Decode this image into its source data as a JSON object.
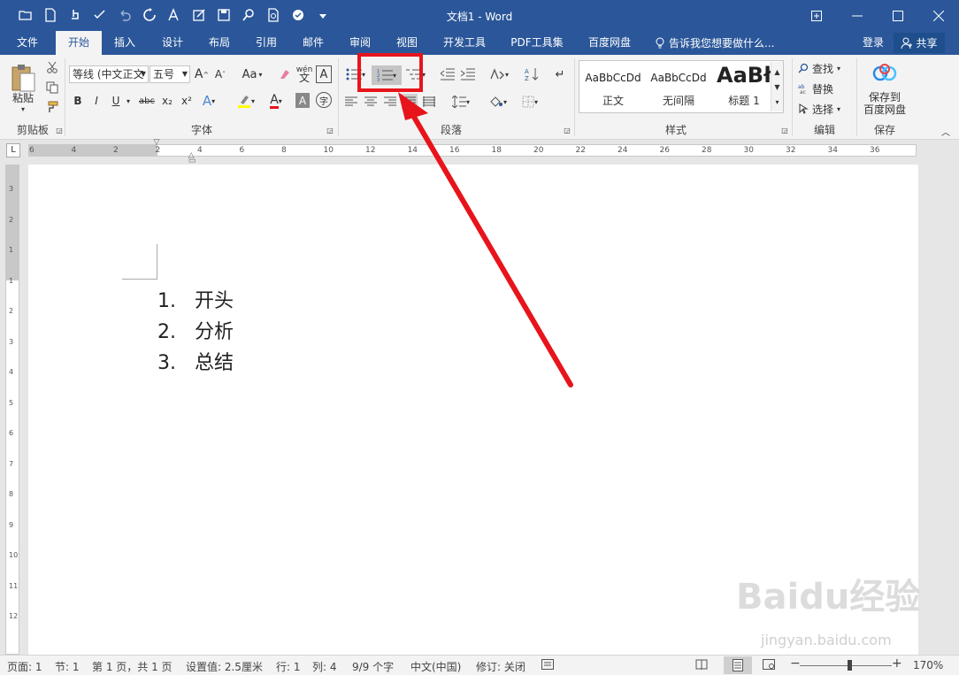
{
  "window": {
    "title": "文档1 - Word"
  },
  "tabs": [
    "文件",
    "开始",
    "插入",
    "设计",
    "布局",
    "引用",
    "邮件",
    "审阅",
    "视图",
    "开发工具",
    "PDF工具集",
    "百度网盘"
  ],
  "tell_me": "告诉我您想要做什么...",
  "login": "登录",
  "share": "共享",
  "clipboard": {
    "paste": "粘贴",
    "label": "剪贴板"
  },
  "font": {
    "name": "等线 (中文正文",
    "size": "五号",
    "label": "字体",
    "aa": "Aa",
    "bold": "B",
    "italic": "I",
    "underline": "U",
    "strike": "abc",
    "sub": "x₂",
    "sup": "x²",
    "wen": "wén",
    "wen_char": "文",
    "a_char": "A",
    "frame_char": "字"
  },
  "paragraph": {
    "label": "段落"
  },
  "styles": {
    "label": "样式",
    "items": [
      {
        "sample": "AaBbCcDd",
        "name": "正文"
      },
      {
        "sample": "AaBbCcDd",
        "name": "无间隔"
      },
      {
        "sample": "AaBł",
        "name": "标题 1"
      }
    ]
  },
  "editing": {
    "label": "编辑",
    "find": "查找",
    "replace": "替换",
    "select": "选择"
  },
  "save": {
    "label": "保存",
    "line1": "保存到",
    "line2": "百度网盘"
  },
  "ruler": {
    "corner": "L",
    "h_ticks": [
      "6",
      "4",
      "2",
      "2",
      "4",
      "6",
      "8",
      "10",
      "12",
      "14",
      "16",
      "18",
      "20",
      "22",
      "24",
      "26",
      "28",
      "30",
      "32",
      "34",
      "36"
    ],
    "v_ticks": [
      "3",
      "2",
      "1",
      "1",
      "2",
      "3",
      "4",
      "5",
      "6",
      "7",
      "8",
      "9",
      "10",
      "11",
      "12"
    ]
  },
  "document": {
    "list": [
      {
        "num": "1.",
        "text": "开头"
      },
      {
        "num": "2.",
        "text": "分析"
      },
      {
        "num": "3.",
        "text": "总结"
      }
    ]
  },
  "status": {
    "page": "页面: 1",
    "section": "节: 1",
    "pages": "第 1 页，共 1 页",
    "setting": "设置值: 2.5厘米",
    "row": "行: 1",
    "col": "列: 4",
    "chars": "9/9 个字",
    "lang": "中文(中国)",
    "track": "修订: 关闭",
    "zoom": "170%"
  },
  "watermark": {
    "brand": "Baidu经验",
    "url": "jingyan.baidu.com"
  },
  "colors": {
    "accent": "#2b579a",
    "highlight": "#e8141c"
  }
}
